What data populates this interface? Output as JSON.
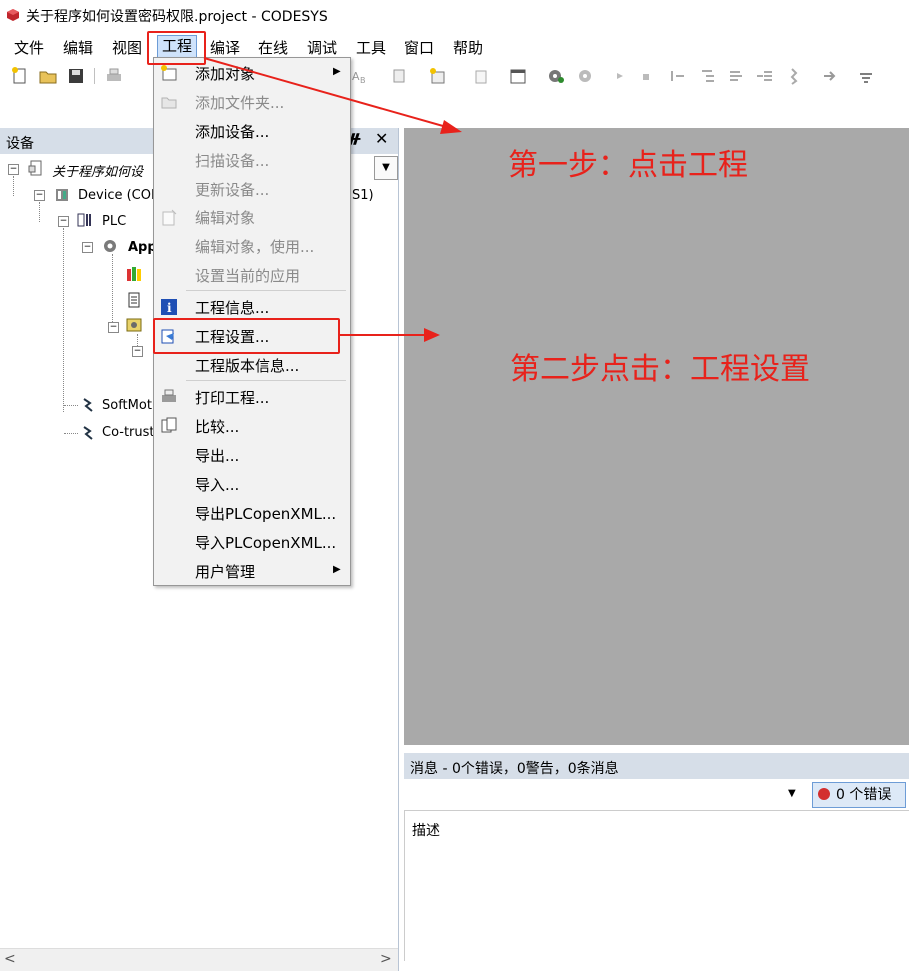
{
  "window": {
    "title": "关于程序如何设置密码权限.project - CODESYS"
  },
  "menubar": {
    "items": [
      "文件",
      "编辑",
      "视图",
      "工程",
      "编译",
      "在线",
      "调试",
      "工具",
      "窗口",
      "帮助"
    ],
    "active": "工程"
  },
  "devices_panel": {
    "title": "设备",
    "pin_glyph": "ㅁ",
    "close_glyph": "✕",
    "tree": {
      "root": "关于程序如何设",
      "device": "Device (COD",
      "device_suffix": "S1)",
      "plc": "PLC",
      "application": "App",
      "softmotion": "SoftMoti",
      "cotrust": "Co-trust"
    }
  },
  "project_menu": {
    "items": [
      {
        "label": "添加对象",
        "enabled": true,
        "submenu": true,
        "icon": "add-object-icon"
      },
      {
        "label": "添加文件夹...",
        "enabled": false,
        "icon": "folder-icon"
      },
      {
        "label": "添加设备...",
        "enabled": true
      },
      {
        "label": "扫描设备...",
        "enabled": false
      },
      {
        "label": "更新设备...",
        "enabled": false
      },
      {
        "label": "编辑对象",
        "enabled": false,
        "icon": "edit-object-icon"
      },
      {
        "label": "编辑对象，使用...",
        "enabled": false
      },
      {
        "label": "设置当前的应用",
        "enabled": false
      },
      {
        "label": "工程信息...",
        "enabled": true,
        "icon": "info-icon"
      },
      {
        "label": "工程设置...",
        "enabled": true,
        "icon": "project-settings-icon"
      },
      {
        "label": "工程版本信息...",
        "enabled": true
      },
      {
        "label": "打印工程...",
        "enabled": true,
        "icon": "printer-icon"
      },
      {
        "label": "比较...",
        "enabled": true,
        "icon": "compare-icon"
      },
      {
        "label": "导出...",
        "enabled": true
      },
      {
        "label": "导入...",
        "enabled": true
      },
      {
        "label": "导出PLCopenXML...",
        "enabled": true
      },
      {
        "label": "导入PLCopenXML...",
        "enabled": true
      },
      {
        "label": "用户管理",
        "enabled": true,
        "submenu": true
      }
    ]
  },
  "messages": {
    "title": "消息 - 0个错误，0警告，0条消息",
    "error_button": "0 个错误",
    "column_description": "描述"
  },
  "annotations": {
    "step1": "第一步：点击工程",
    "step2": "第二步点击：工程设置"
  },
  "colors": {
    "annotation": "#e8221b",
    "editor_bg": "#a9a9a9",
    "panel_header": "#d6dee8"
  }
}
